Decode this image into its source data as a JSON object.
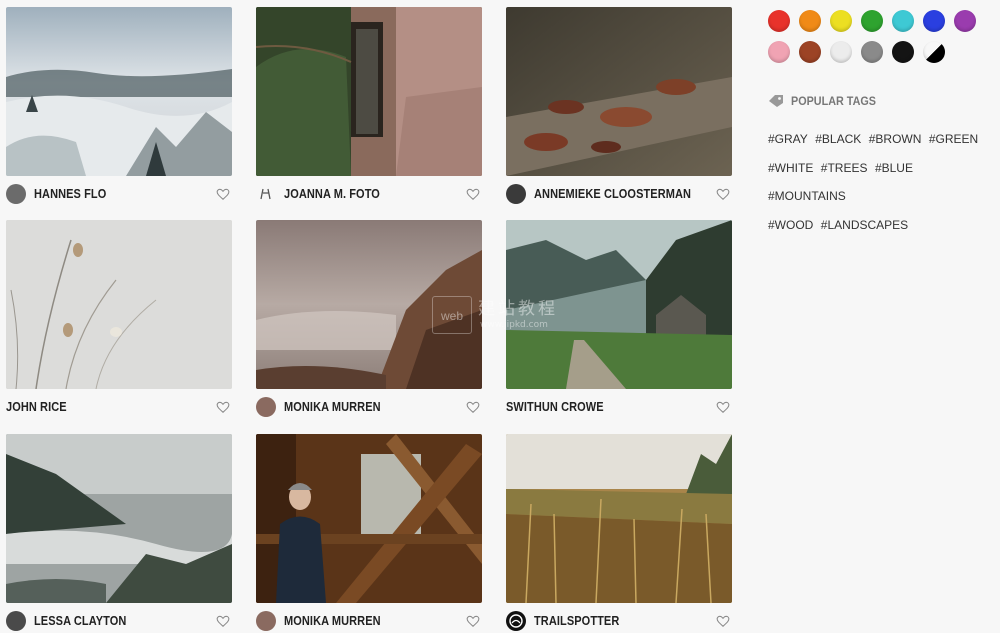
{
  "gallery": [
    {
      "author": "HANNES FLO",
      "avatar": "photo"
    },
    {
      "author": "JOANNA M. FOTO",
      "avatar": "logo"
    },
    {
      "author": "ANNEMIEKE CLOOSTERMAN",
      "avatar": "photo"
    },
    {
      "author": "JOHN RICE",
      "avatar": "none"
    },
    {
      "author": "MONIKA MURREN",
      "avatar": "photo"
    },
    {
      "author": "SWITHUN CROWE",
      "avatar": "none"
    },
    {
      "author": "LESSA CLAYTON",
      "avatar": "photo"
    },
    {
      "author": "MONIKA MURREN",
      "avatar": "photo"
    },
    {
      "author": "TRAILSPOTTER",
      "avatar": "logo"
    }
  ],
  "sidebar": {
    "colors": [
      {
        "name": "red",
        "hex": "#e8322b"
      },
      {
        "name": "orange",
        "hex": "#f08a17"
      },
      {
        "name": "yellow",
        "hex": "#ecdf22"
      },
      {
        "name": "green",
        "hex": "#2ea32f"
      },
      {
        "name": "cyan",
        "hex": "#3ec9d4"
      },
      {
        "name": "blue",
        "hex": "#2a3fe0"
      },
      {
        "name": "purple",
        "hex": "#9a3cae"
      },
      {
        "name": "pink",
        "hex": "#f0a3b3"
      },
      {
        "name": "brown",
        "hex": "#9c4325"
      },
      {
        "name": "white",
        "hex": "#ececec"
      },
      {
        "name": "gray",
        "hex": "#8a8a8a"
      },
      {
        "name": "black",
        "hex": "#141414"
      },
      {
        "name": "black-white",
        "hex": "#000000"
      }
    ],
    "tags_heading": "POPULAR TAGS",
    "tags": [
      "#GRAY",
      "#BLACK",
      "#BROWN",
      "#GREEN",
      "#WHITE",
      "#TREES",
      "#BLUE",
      "#MOUNTAINS",
      "#WOOD",
      "#LANDSCAPES"
    ]
  },
  "watermark": {
    "box": "web",
    "title": "建站教程",
    "url": "www.jipkd.com"
  }
}
